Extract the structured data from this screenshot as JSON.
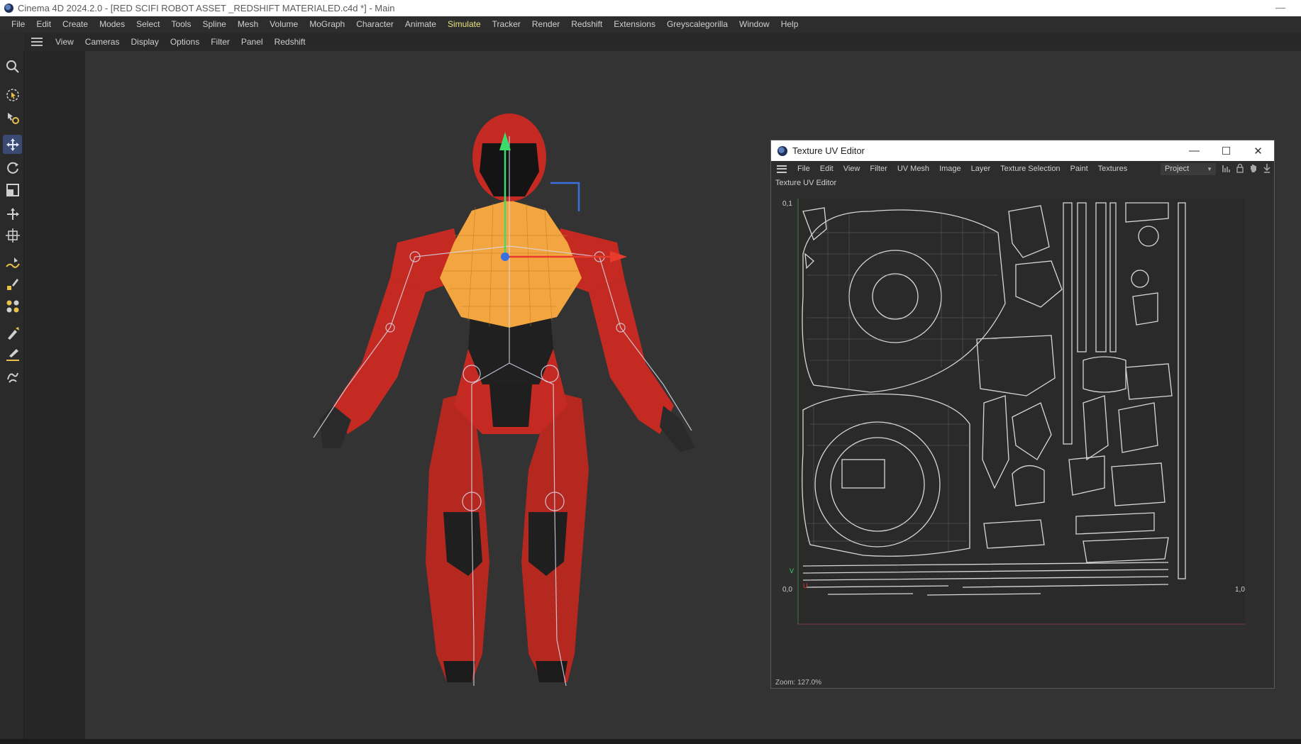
{
  "window": {
    "title": "Cinema 4D 2024.2.0 - [RED SCIFI ROBOT ASSET _REDSHIFT MATERIALED.c4d *] - Main",
    "minimize": "—"
  },
  "main_menu": [
    {
      "label": "File"
    },
    {
      "label": "Edit"
    },
    {
      "label": "Create"
    },
    {
      "label": "Modes"
    },
    {
      "label": "Select"
    },
    {
      "label": "Tools"
    },
    {
      "label": "Spline"
    },
    {
      "label": "Mesh"
    },
    {
      "label": "Volume"
    },
    {
      "label": "MoGraph"
    },
    {
      "label": "Character"
    },
    {
      "label": "Animate"
    },
    {
      "label": "Simulate"
    },
    {
      "label": "Tracker"
    },
    {
      "label": "Render"
    },
    {
      "label": "Redshift"
    },
    {
      "label": "Extensions"
    },
    {
      "label": "Greyscalegorilla"
    },
    {
      "label": "Window"
    },
    {
      "label": "Help"
    }
  ],
  "active_menu": "Simulate",
  "viewport_menu": [
    {
      "label": "View"
    },
    {
      "label": "Cameras"
    },
    {
      "label": "Display"
    },
    {
      "label": "Options"
    },
    {
      "label": "Filter"
    },
    {
      "label": "Panel"
    },
    {
      "label": "Redshift"
    }
  ],
  "tools": [
    {
      "icon": "search-icon"
    },
    {
      "icon": "live-selection-icon"
    },
    {
      "icon": "selection-settings-icon"
    },
    {
      "icon": "move-icon",
      "selected": true
    },
    {
      "icon": "rotate-icon"
    },
    {
      "icon": "scale-icon"
    },
    {
      "icon": "placement-icon"
    },
    {
      "icon": "transform-icon"
    },
    {
      "icon": "spline-pen-icon"
    },
    {
      "icon": "paint-icon"
    },
    {
      "icon": "mograph-icon"
    },
    {
      "icon": "brush-icon"
    },
    {
      "icon": "knife-icon"
    },
    {
      "icon": "sculpt-icon"
    }
  ],
  "uv_editor": {
    "title": "Texture UV Editor",
    "panel_title": "Texture UV Editor",
    "minimize": "—",
    "maximize": "☐",
    "close": "✕",
    "menu": [
      {
        "label": "File"
      },
      {
        "label": "Edit"
      },
      {
        "label": "View"
      },
      {
        "label": "Filter"
      },
      {
        "label": "UV Mesh"
      },
      {
        "label": "Image"
      },
      {
        "label": "Layer"
      },
      {
        "label": "Texture Selection"
      },
      {
        "label": "Paint"
      },
      {
        "label": "Textures"
      }
    ],
    "project_select": "Project",
    "axis_top_left": "0,1",
    "axis_bottom_left": "0,0",
    "axis_bottom_right": "1,0",
    "axis_v": "V",
    "axis_u": "U",
    "zoom": "Zoom: 127.0%"
  },
  "colors": {
    "accent": "#3a4a73",
    "robot_red": "#c42a22",
    "selection_orange": "#f3a640",
    "uv_wire": "#d8d8d8",
    "gizmo_y": "#3ddc6a",
    "gizmo_x": "#e83b2b",
    "gizmo_z": "#3a6fe0"
  }
}
